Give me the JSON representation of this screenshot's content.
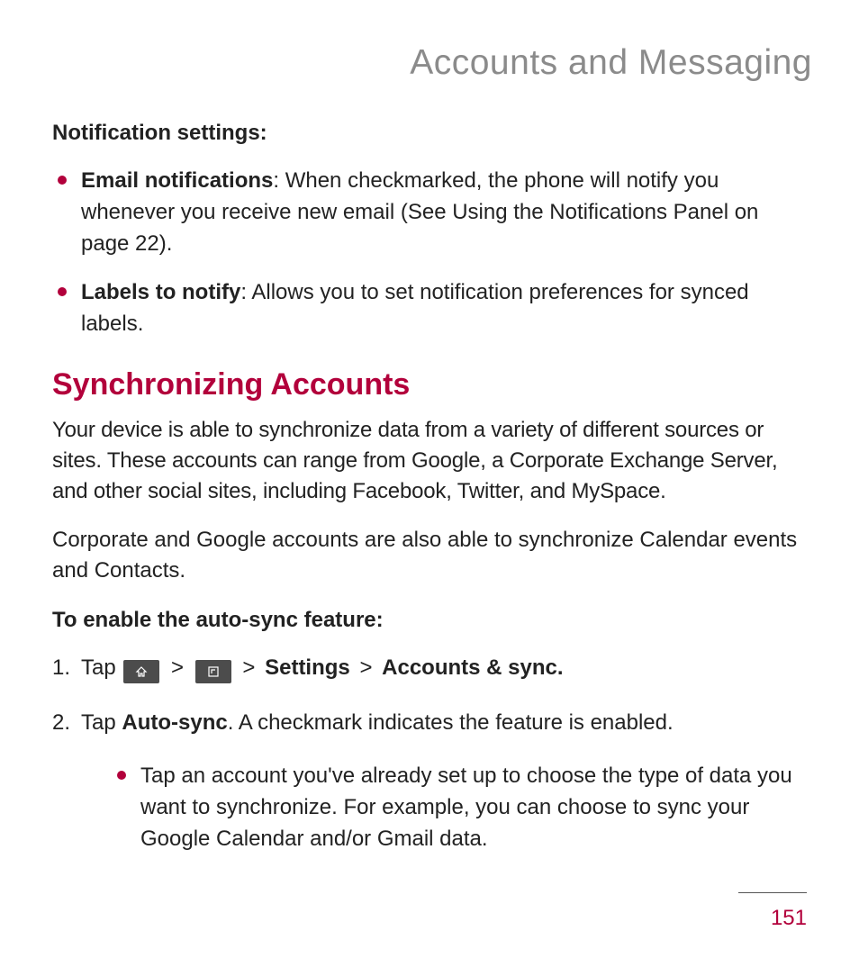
{
  "header": {
    "title": "Accounts and Messaging"
  },
  "notification": {
    "heading": "Notification settings:",
    "items": [
      {
        "bold": "Email notifications",
        "rest": ": When checkmarked, the phone will notify you whenever you receive new email (See Using the Notifications Panel on page 22)."
      },
      {
        "bold": "Labels to notify",
        "rest": ": Allows you to set notification preferences for synced labels."
      }
    ]
  },
  "sync": {
    "heading": "Synchronizing Accounts",
    "para1": "Your device is able to synchronize data from a variety of different sources or sites. These accounts can range from Google, a Corporate Exchange Server, and other social sites, including Facebook, Twitter, and MySpace.",
    "para2": "Corporate and Google accounts are also able to synchronize Calendar events and Contacts.",
    "subheading": "To enable the auto-sync feature:",
    "step1": {
      "lead": "Tap ",
      "gt": ">",
      "settings": "Settings",
      "accounts": "Accounts & sync."
    },
    "step2": {
      "lead": "Tap ",
      "bold": "Auto-sync",
      "rest": ". A checkmark indicates the feature is enabled."
    },
    "nested": "Tap an account you've already set up to choose the type of data you want to synchronize. For example, you can choose to sync your Google Calendar and/or Gmail data."
  },
  "footer": {
    "page": "151"
  }
}
